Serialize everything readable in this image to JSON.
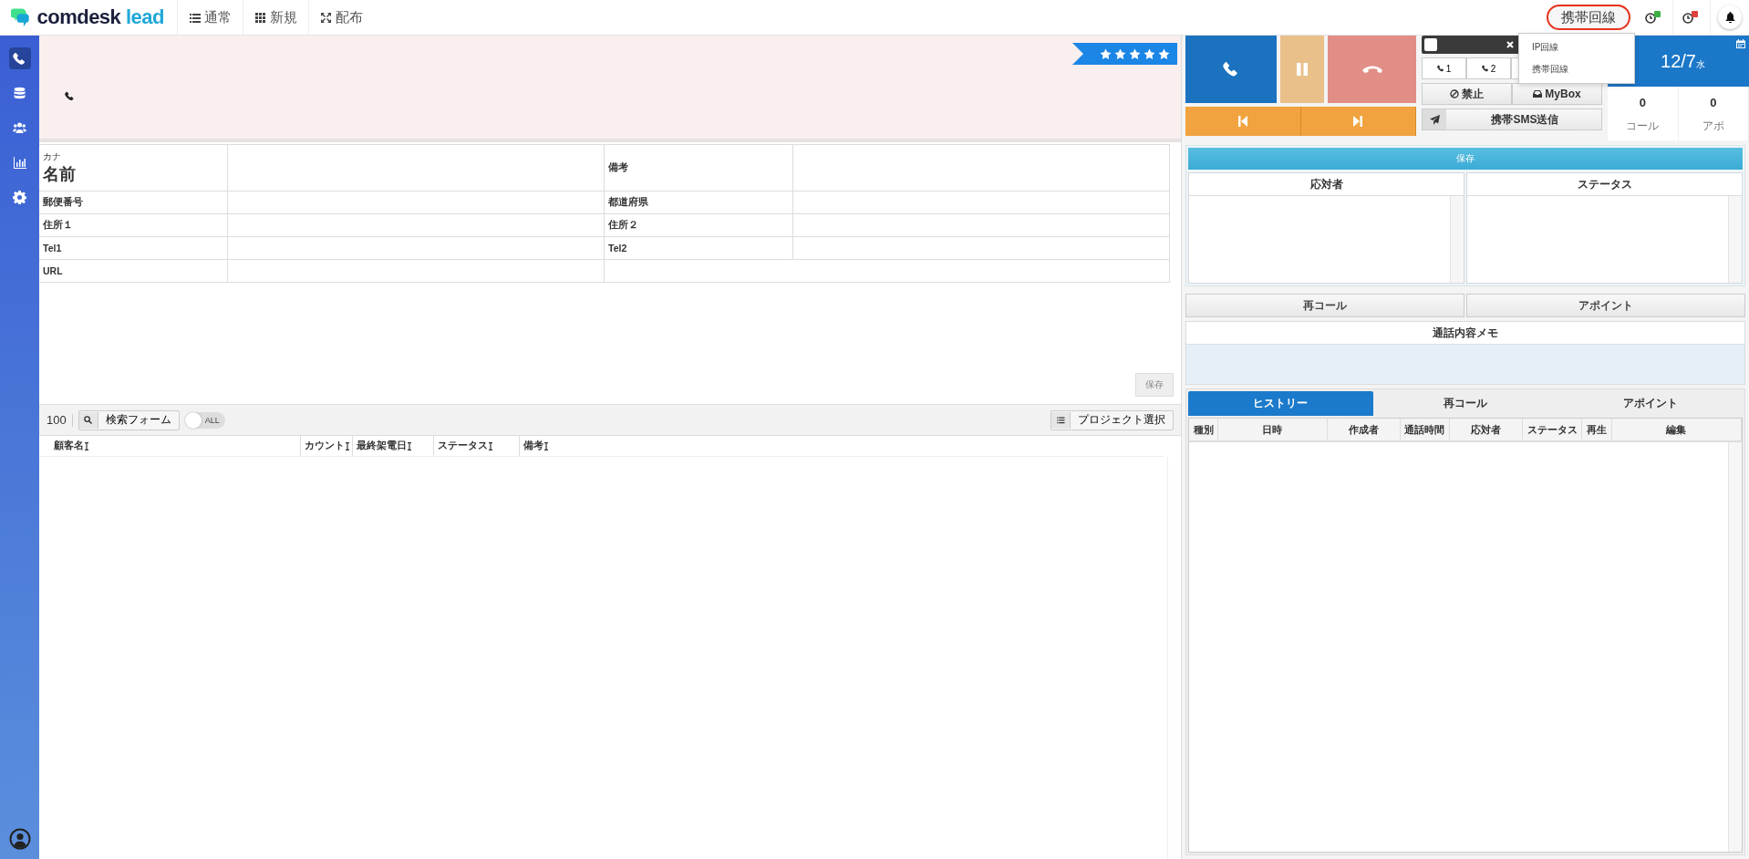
{
  "header": {
    "logo_dark": "comdesk",
    "logo_light": "lead",
    "nav": [
      {
        "label": "通常",
        "kind": "list"
      },
      {
        "label": "新規",
        "kind": "grid"
      },
      {
        "label": "配布",
        "kind": "expand"
      }
    ],
    "line_button": "携帯回線",
    "line_menu": [
      "IP回線",
      "携帯回線"
    ]
  },
  "sidebar": {
    "items": [
      {
        "kind": "phone",
        "selected": true
      },
      {
        "kind": "database",
        "selected": false
      },
      {
        "kind": "users",
        "selected": false
      },
      {
        "kind": "chart",
        "selected": false
      },
      {
        "kind": "gear",
        "selected": false
      }
    ]
  },
  "banner": {
    "stars": 5
  },
  "form": {
    "rows": [
      {
        "label_small": "カナ",
        "label": "名前",
        "label2": "備考"
      },
      {
        "label": "郵便番号",
        "label2": "都道府県"
      },
      {
        "label": "住所１",
        "label2": "住所２"
      },
      {
        "label": "Tel1",
        "label2": "Tel2"
      },
      {
        "label": "URL"
      }
    ],
    "save": "保存"
  },
  "list": {
    "count": "100",
    "search_button": "検索フォーム",
    "toggle": {
      "label": "ALL",
      "on": false
    },
    "project_button": "プロジェクト選択",
    "columns": [
      "顧客名",
      "カウント",
      "最終架電日",
      "ステータス",
      "備考"
    ]
  },
  "call": {
    "checked": false,
    "lines": [
      "1",
      "2"
    ],
    "block": "禁止",
    "mybox": "MyBox",
    "sms": "携帯SMS送信",
    "date": "12/7",
    "weekday": "水",
    "counts": [
      {
        "value": "0",
        "label": "コール"
      },
      {
        "value": "0",
        "label": "アポ"
      }
    ]
  },
  "result": {
    "save": "保存",
    "columns": [
      "応対者",
      "ステータス"
    ],
    "recall": "再コール",
    "appoint": "アポイント",
    "memo_title": "通話内容メモ"
  },
  "history": {
    "tabs": [
      {
        "label": "ヒストリー",
        "selected": true
      },
      {
        "label": "再コール",
        "selected": false
      },
      {
        "label": "アポイント",
        "selected": false
      }
    ],
    "columns": [
      "種別",
      "日時",
      "作成者",
      "通話時間",
      "応対者",
      "ステータス",
      "再生",
      "編集"
    ]
  }
}
